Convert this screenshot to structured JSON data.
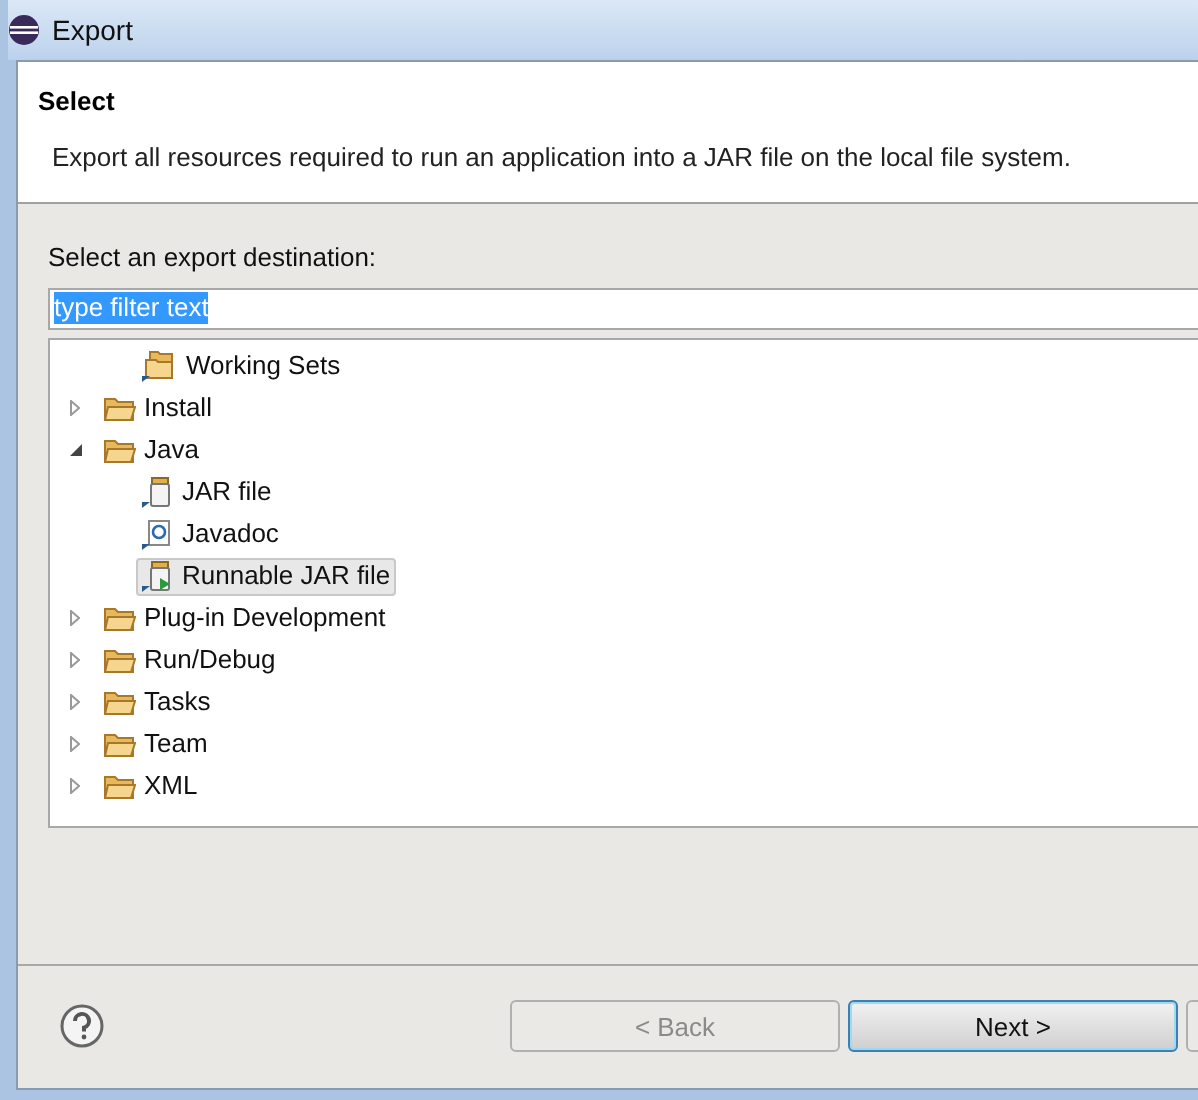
{
  "window": {
    "title": "Export"
  },
  "header": {
    "title": "Select",
    "description": "Export all resources required to run an application into a JAR file on the local file system."
  },
  "destination_label": "Select an export destination:",
  "filter": {
    "value": "type filter text",
    "highlighted": true
  },
  "tree": {
    "items": [
      {
        "children": [
          {
            "label": "Working Sets",
            "kind": "working-set",
            "selected": false
          }
        ]
      },
      {
        "label": "Install",
        "kind": "folder",
        "expanded": false,
        "selected": false
      },
      {
        "label": "Java",
        "kind": "folder",
        "expanded": true,
        "selected": false,
        "children": [
          {
            "label": "JAR file",
            "kind": "jar",
            "selected": false
          },
          {
            "label": "Javadoc",
            "kind": "javadoc",
            "selected": false
          },
          {
            "label": "Runnable JAR file",
            "kind": "runnable-jar",
            "selected": true
          }
        ]
      },
      {
        "label": "Plug-in Development",
        "kind": "folder",
        "expanded": false,
        "selected": false
      },
      {
        "label": "Run/Debug",
        "kind": "folder",
        "expanded": false,
        "selected": false
      },
      {
        "label": "Tasks",
        "kind": "folder",
        "expanded": false,
        "selected": false
      },
      {
        "label": "Team",
        "kind": "folder",
        "expanded": false,
        "selected": false
      },
      {
        "label": "XML",
        "kind": "folder",
        "expanded": false,
        "selected": false
      }
    ]
  },
  "buttons": [
    {
      "label": "< Back",
      "disabled": true,
      "default": false
    },
    {
      "label": "Next >",
      "disabled": false,
      "default": true
    }
  ]
}
